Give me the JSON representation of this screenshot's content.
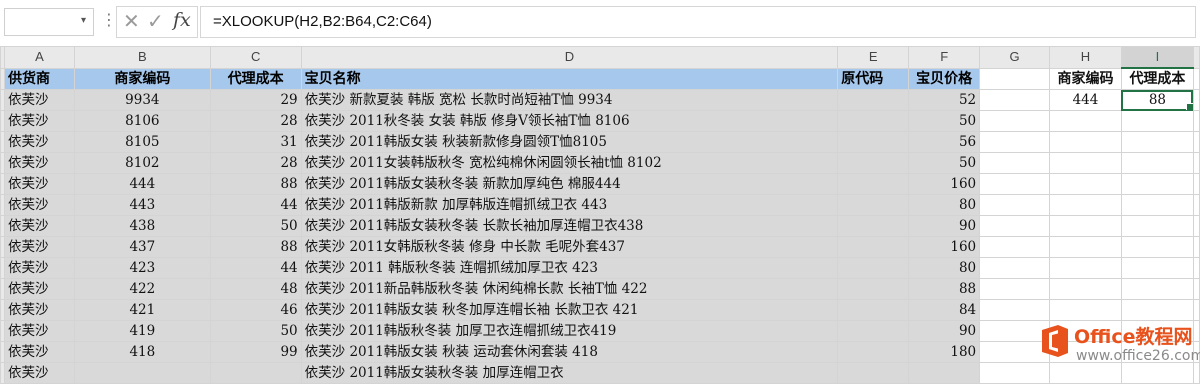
{
  "formula_bar": {
    "name_box": "",
    "fx_label": "fx",
    "formula": "=XLOOKUP(H2,B2:B64,C2:C64)"
  },
  "column_letters": [
    "A",
    "B",
    "C",
    "D",
    "E",
    "F",
    "G",
    "H",
    "I"
  ],
  "headers": [
    "供货商",
    "商家编码",
    "代理成本",
    "宝贝名称",
    "原代码",
    "宝贝价格"
  ],
  "rows": [
    {
      "a": "依芙沙",
      "b": "9934",
      "c": "29",
      "d": "依芙沙 新款夏装 韩版 宽松 长款时尚短袖T恤 9934",
      "e": "",
      "f": "52"
    },
    {
      "a": "依芙沙",
      "b": "8106",
      "c": "28",
      "d": "依芙沙 2011秋冬装 女装 韩版 修身V领长袖T恤 8106",
      "e": "",
      "f": "50"
    },
    {
      "a": "依芙沙",
      "b": "8105",
      "c": "31",
      "d": "依芙沙 2011韩版女装 秋装新款修身圆领T恤8105",
      "e": "",
      "f": "56"
    },
    {
      "a": "依芙沙",
      "b": "8102",
      "c": "28",
      "d": "依芙沙 2011女装韩版秋冬 宽松纯棉休闲圆领长袖t恤 8102",
      "e": "",
      "f": "50"
    },
    {
      "a": "依芙沙",
      "b": "444",
      "c": "88",
      "d": "依芙沙 2011韩版女装秋冬装 新款加厚纯色 棉服444",
      "e": "",
      "f": "160"
    },
    {
      "a": "依芙沙",
      "b": "443",
      "c": "44",
      "d": "依芙沙 2011韩版新款 加厚韩版连帽抓绒卫衣 443",
      "e": "",
      "f": "80"
    },
    {
      "a": "依芙沙",
      "b": "438",
      "c": "50",
      "d": "依芙沙 2011韩版女装秋冬装 长款长袖加厚连帽卫衣438",
      "e": "",
      "f": "90"
    },
    {
      "a": "依芙沙",
      "b": "437",
      "c": "88",
      "d": "依芙沙 2011女韩版秋冬装 修身 中长款 毛呢外套437",
      "e": "",
      "f": "160"
    },
    {
      "a": "依芙沙",
      "b": "423",
      "c": "44",
      "d": "依芙沙 2011 韩版秋冬装 连帽抓绒加厚卫衣 423",
      "e": "",
      "f": "80"
    },
    {
      "a": "依芙沙",
      "b": "422",
      "c": "48",
      "d": "依芙沙 2011新品韩版秋冬装 休闲纯棉长款 长袖T恤 422",
      "e": "",
      "f": "88"
    },
    {
      "a": "依芙沙",
      "b": "421",
      "c": "46",
      "d": "依芙沙 2011韩版女装 秋冬加厚连帽长袖 长款卫衣 421",
      "e": "",
      "f": "84"
    },
    {
      "a": "依芙沙",
      "b": "419",
      "c": "50",
      "d": "依芙沙 2011韩版秋冬装 加厚卫衣连帽抓绒卫衣419",
      "e": "",
      "f": "90"
    },
    {
      "a": "依芙沙",
      "b": "418",
      "c": "99",
      "d": "依芙沙 2011韩版女装 秋装 运动套休闲套装 418",
      "e": "",
      "f": "180"
    },
    {
      "a": "依芙沙",
      "b": "",
      "c": "",
      "d": "依芙沙 2011韩版女装秋冬装 加厚连帽卫衣",
      "e": "",
      "f": ""
    }
  ],
  "lookup": {
    "h_header": "商家编码",
    "i_header": "代理成本",
    "h_value": "444",
    "i_value": "88"
  },
  "watermark": {
    "brand": "Office教程网",
    "url": "www.office26.com"
  },
  "colors": {
    "header_fill": "#a6c8ec",
    "data_fill": "#d9d9d9",
    "selection": "#217346",
    "watermark_orange": "#e8521c"
  }
}
